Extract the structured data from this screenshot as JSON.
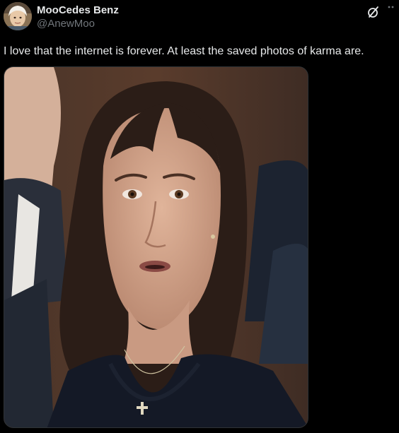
{
  "post": {
    "display_name": "MooCedes Benz",
    "handle": "@AnewMoo",
    "text": "I love that the internet is forever. At least the saved photos of karma are.",
    "more_icon": "more-dots-icon",
    "grok_icon": "grok-icon"
  },
  "colors": {
    "background": "#000000",
    "text_primary": "#e7e9ea",
    "text_secondary": "#71767b"
  }
}
